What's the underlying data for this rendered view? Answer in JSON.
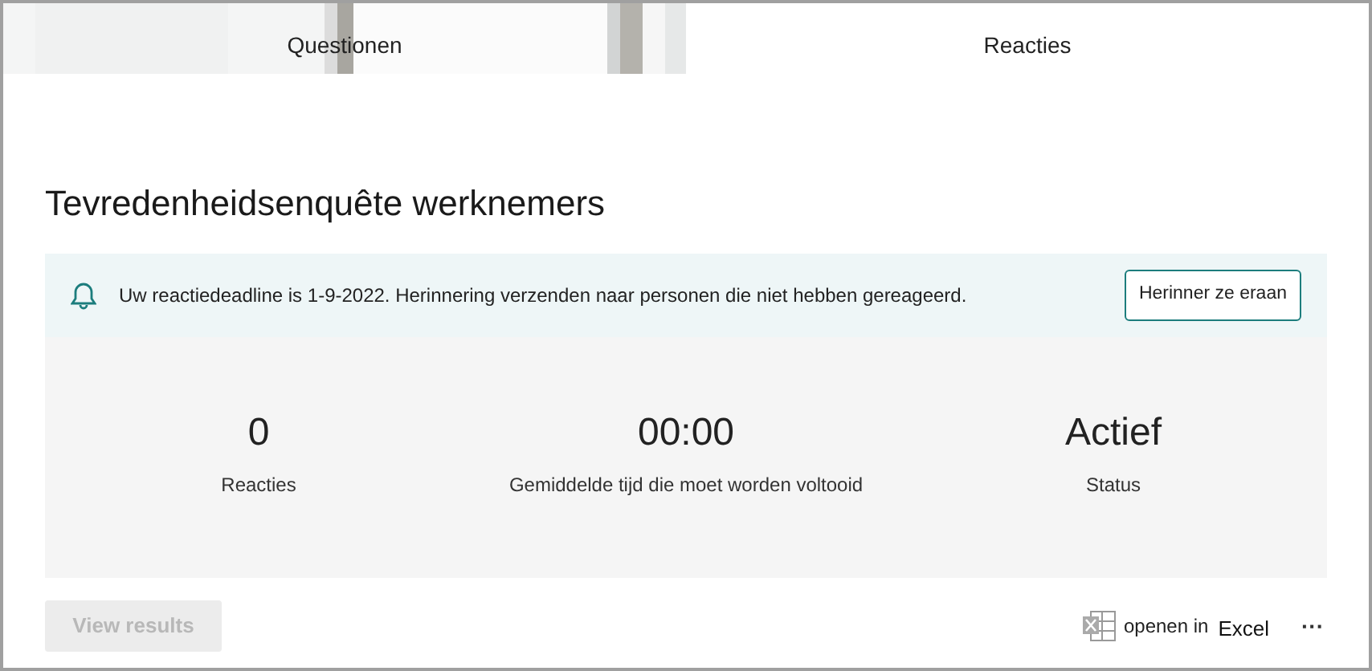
{
  "tabs": [
    {
      "label": "Questionen",
      "kind": "picture"
    },
    {
      "label": "Reacties",
      "kind": "plain"
    }
  ],
  "title": "Tevredenheidsenquête werknemers",
  "banner": {
    "text": "Uw reactiedeadline is 1-9-2022. Herinnering verzenden naar personen die niet hebben gereageerd.",
    "button": "Herinner ze eraan"
  },
  "stats": [
    {
      "value": "0",
      "label": "Reacties"
    },
    {
      "value": "00:00",
      "label": "Gemiddelde tijd die moet worden voltooid"
    },
    {
      "value": "Actief",
      "label": "Status"
    }
  ],
  "view_button": {
    "label": "View results",
    "disabled": true
  },
  "export": {
    "prefix": "openen in",
    "app": "Excel",
    "more": "···"
  }
}
